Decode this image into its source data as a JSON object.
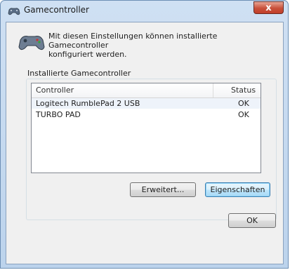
{
  "window": {
    "title": "Gamecontroller",
    "close_glyph": "x"
  },
  "header": {
    "text_line1": "Mit diesen Einstellungen können installierte Gamecontroller",
    "text_line2": "konfiguriert werden."
  },
  "group": {
    "label": "Installierte Gamecontroller"
  },
  "list": {
    "columns": {
      "controller": "Controller",
      "status": "Status"
    },
    "rows": [
      {
        "name": "Logitech RumblePad 2 USB",
        "status": "OK"
      },
      {
        "name": "TURBO PAD",
        "status": "OK"
      }
    ]
  },
  "buttons": {
    "advanced": "Erweitert...",
    "properties": "Eigenschaften",
    "ok": "OK"
  },
  "icons": {
    "title": "gamepad-icon",
    "header": "gamepad-icon"
  }
}
